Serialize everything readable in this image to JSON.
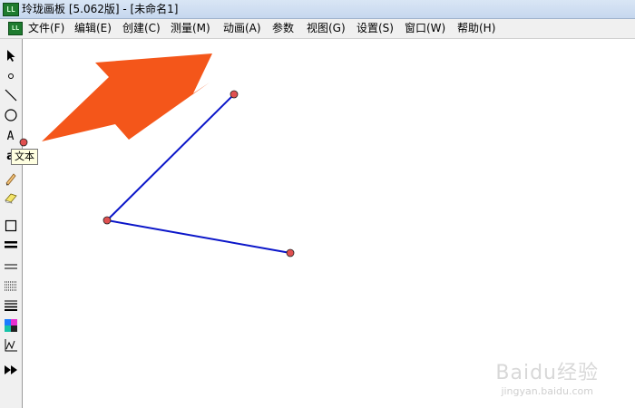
{
  "window": {
    "title": "玲珑画板 [5.062版] - [未命名1]",
    "icon": "LL"
  },
  "menubar": {
    "items": [
      "文件(F)",
      "编辑(E)",
      "创建(C)",
      "测量(M)",
      "动画(A)",
      "参数",
      "视图(G)",
      "设置(S)",
      "窗口(W)",
      "帮助(H)"
    ]
  },
  "toolbox": {
    "tools": [
      "select-arrow-icon",
      "point-icon",
      "line-segment-icon",
      "circle-icon",
      "text-tool-icon",
      "text-label-icon",
      "pencil-icon",
      "eraser-icon",
      "rectangle-icon",
      "thick-line-icon",
      "line-style-icon",
      "dotted-fill-icon",
      "line-weight-icon",
      "color-palette-icon",
      "graph-icon",
      "fast-forward-icon"
    ],
    "text_tool_glyph": "A",
    "label_tool_glyph": "a"
  },
  "tooltip": {
    "text": "文本"
  },
  "canvas": {
    "line_color": "#0b16c9",
    "point_fill": "#e05050",
    "arrow_color": "#f4561a"
  },
  "watermark": {
    "brand": "Baidu经验",
    "url": "jingyan.baidu.com"
  }
}
